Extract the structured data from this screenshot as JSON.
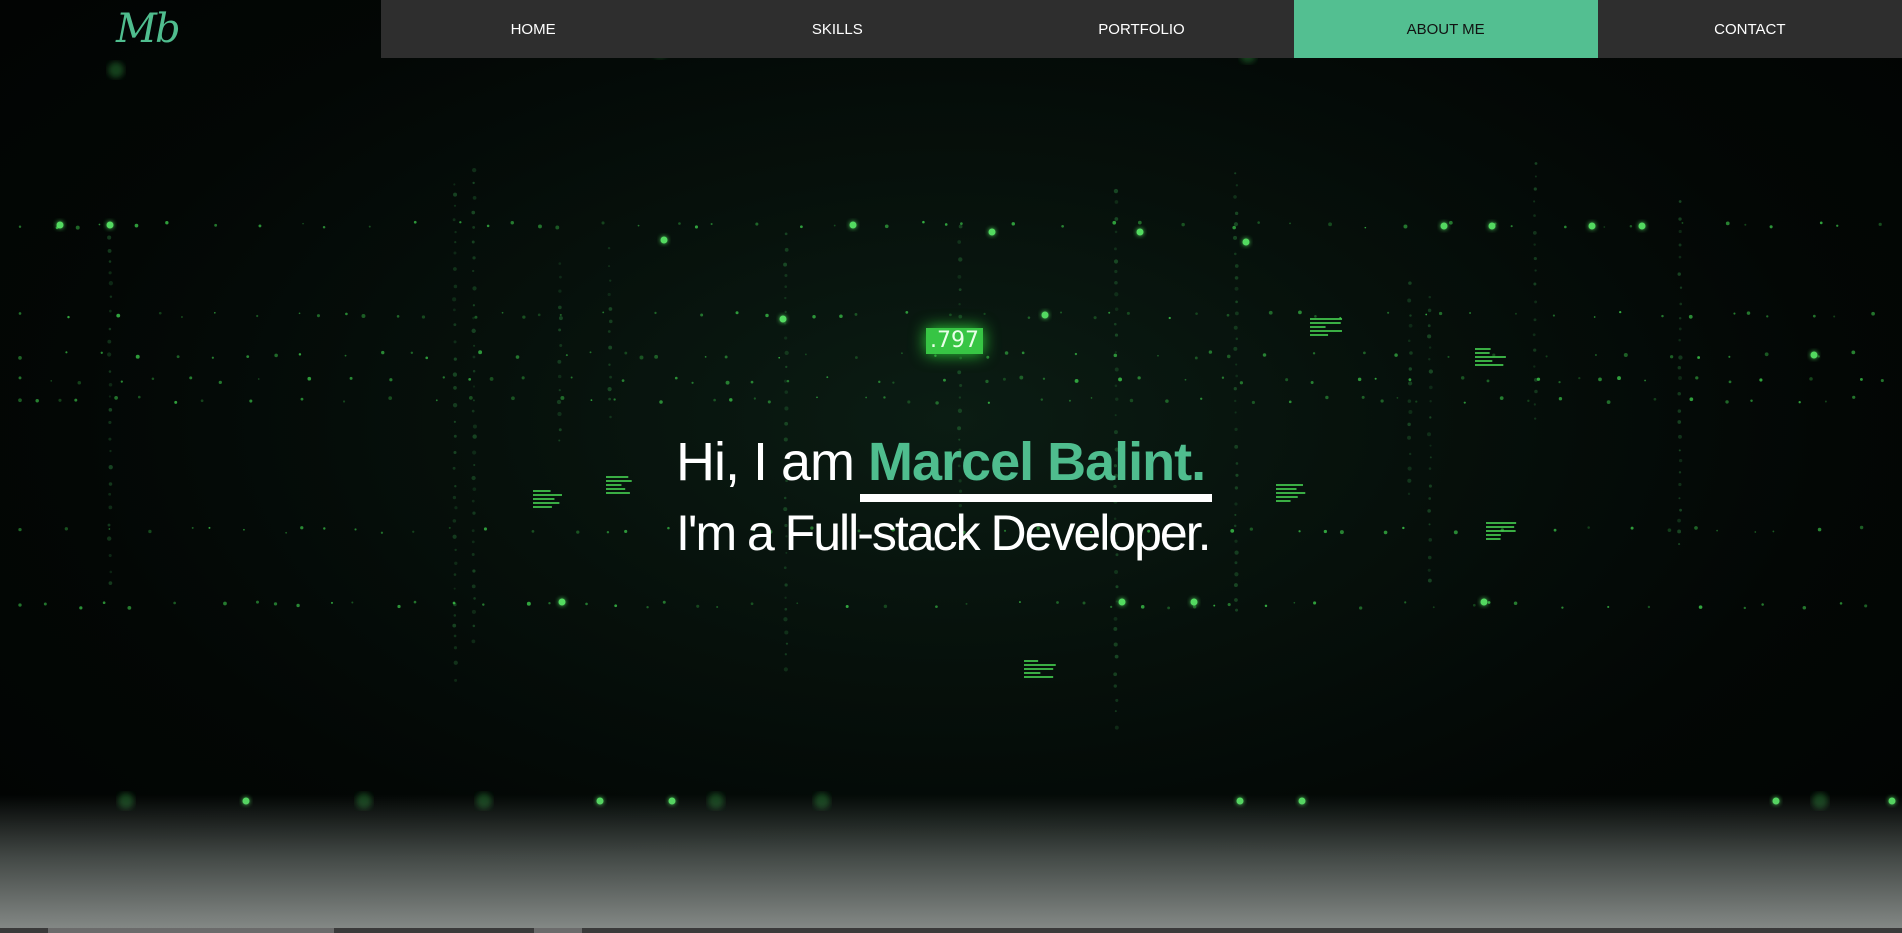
{
  "logo": {
    "text": "Mb",
    "color": "#4fbd8e"
  },
  "nav": {
    "items": [
      {
        "label": "HOME",
        "active": false
      },
      {
        "label": "SKILLS",
        "active": false
      },
      {
        "label": "PORTFOLIO",
        "active": false
      },
      {
        "label": "ABOUT ME",
        "active": true
      },
      {
        "label": "CONTACT",
        "active": false
      }
    ],
    "active_color": "#53bf91"
  },
  "hero": {
    "greeting": "Hi, I am ",
    "name": "Marcel Balint.",
    "subtitle": "I'm a Full-stack Developer."
  },
  "background": {
    "badge_text": ".797",
    "theme": "matrix-green"
  }
}
